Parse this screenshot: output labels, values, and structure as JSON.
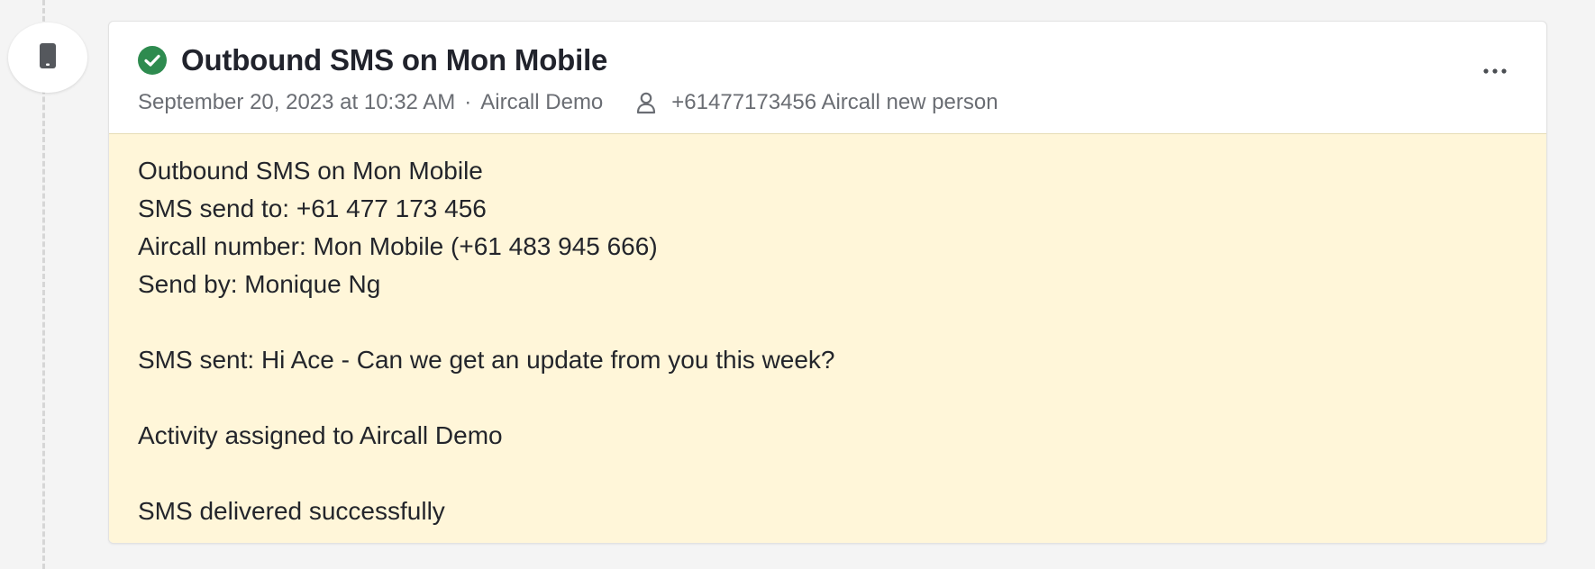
{
  "activity": {
    "title": "Outbound SMS on Mon Mobile",
    "date": "September 20, 2023 at 10:32 AM",
    "separator": "·",
    "owner": "Aircall Demo",
    "contact": "+61477173456 Aircall new person",
    "status_icon": "check-circle-icon",
    "type_icon": "mobile-phone-icon",
    "menu_icon": "more-horizontal-icon"
  },
  "note": {
    "lines": [
      "Outbound SMS on Mon Mobile",
      "SMS send to: +61 477 173 456",
      "Aircall number: Mon Mobile (+61 483 945 666)",
      "Send by: Monique Ng",
      "",
      "SMS sent: Hi Ace - Can we get an update from you this week?",
      "",
      "Activity assigned to Aircall Demo",
      "",
      "SMS delivered successfully"
    ]
  },
  "colors": {
    "success": "#2e8b4f",
    "note_background": "#fff6d9",
    "page_background": "#f4f4f4"
  }
}
